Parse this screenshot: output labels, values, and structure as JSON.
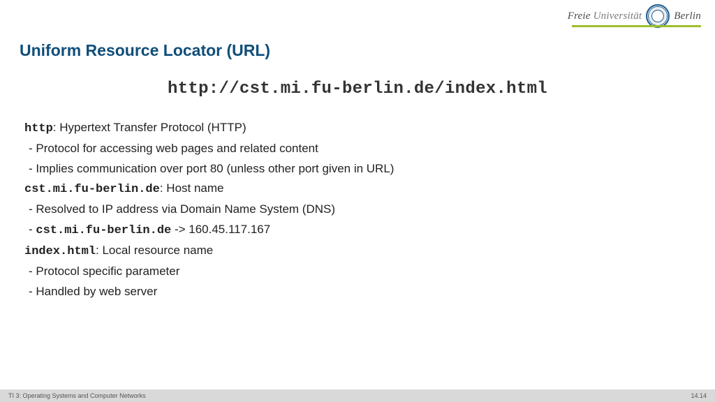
{
  "header": {
    "logo_w1": "Freie",
    "logo_w2": "Universität",
    "logo_w3": "Berlin"
  },
  "title": "Uniform Resource Locator (URL)",
  "url_example": "http://cst.mi.fu-berlin.de/index.html",
  "sections": [
    {
      "term": "http",
      "desc": ": Hypertext Transfer Protocol (HTTP)"
    },
    {
      "bullet": "Protocol for accessing web pages and related content"
    },
    {
      "bullet": "Implies communication over port 80 (unless other port given in URL)"
    },
    {
      "term": "cst.mi.fu-berlin.de",
      "desc": ": Host name"
    },
    {
      "bullet": "Resolved to IP address via Domain Name System (DNS)"
    },
    {
      "bullet_mono_prefix": "cst.mi.fu-berlin.de",
      "bullet_suffix": " -> 160.45.117.167"
    },
    {
      "term": "index.html",
      "desc": ": Local resource name"
    },
    {
      "bullet": "Protocol specific parameter"
    },
    {
      "bullet": "Handled by web server"
    }
  ],
  "footer": {
    "left": "TI 3: Operating Systems and Computer Networks",
    "right": "14.14"
  }
}
